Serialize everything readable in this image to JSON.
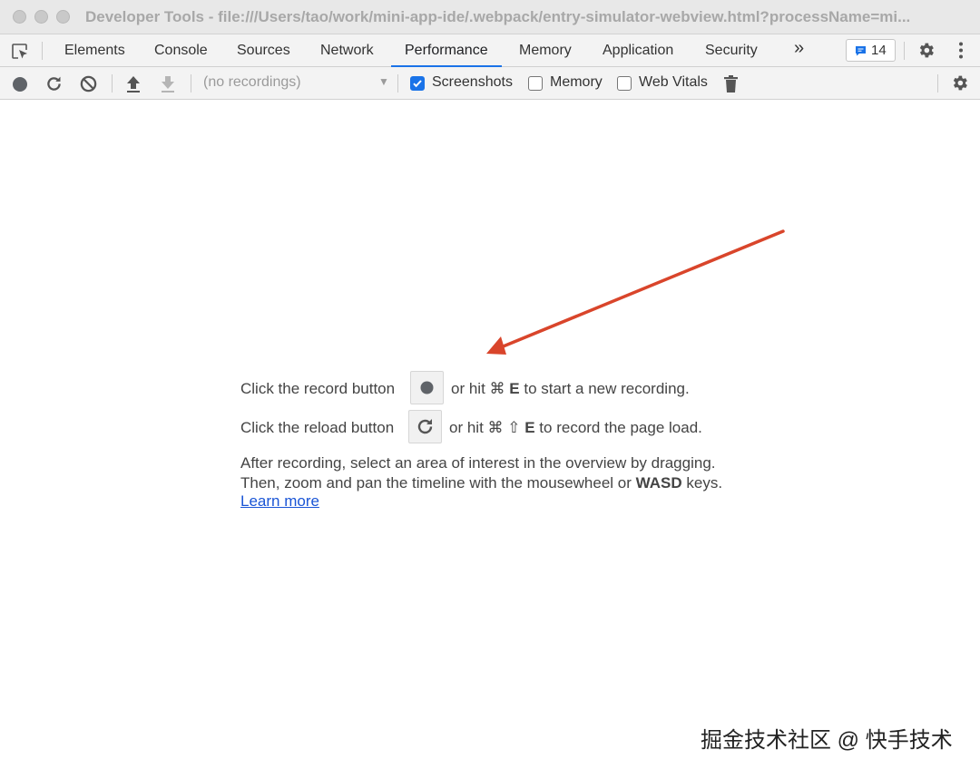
{
  "window": {
    "title": "Developer Tools - file:///Users/tao/work/mini-app-ide/.webpack/entry-simulator-webview.html?processName=mi..."
  },
  "tabs": [
    {
      "label": "Elements"
    },
    {
      "label": "Console"
    },
    {
      "label": "Sources"
    },
    {
      "label": "Network"
    },
    {
      "label": "Performance",
      "active": true
    },
    {
      "label": "Memory"
    },
    {
      "label": "Application"
    },
    {
      "label": "Security"
    }
  ],
  "tabbar": {
    "more_label": "»",
    "issues_count": "14"
  },
  "toolbar": {
    "recordings_value": "(no recordings)",
    "screenshots_label": "Screenshots",
    "screenshots_checked": true,
    "memory_label": "Memory",
    "memory_checked": false,
    "web_vitals_label": "Web Vitals",
    "web_vitals_checked": false
  },
  "landing": {
    "record_prefix": "Click the record button",
    "record_suffix_pre": "or hit ⌘",
    "record_key": "E",
    "record_suffix_post": "to start a new recording.",
    "reload_prefix": "Click the reload button",
    "reload_suffix_pre": "or hit ⌘ ⇧",
    "reload_key": "E",
    "reload_suffix_post": "to record the page load.",
    "info_line1": "After recording, select an area of interest in the overview by dragging.",
    "info_line2_pre": "Then, zoom and pan the timeline with the mousewheel or",
    "info_line2_keys": "WASD",
    "info_line2_post": "keys.",
    "learn_more": "Learn more"
  },
  "watermark": "掘金技术社区 @ 快手技术",
  "colors": {
    "accent": "#1a73e8",
    "annotation_arrow": "#d9452b",
    "link": "#1a55d6"
  }
}
